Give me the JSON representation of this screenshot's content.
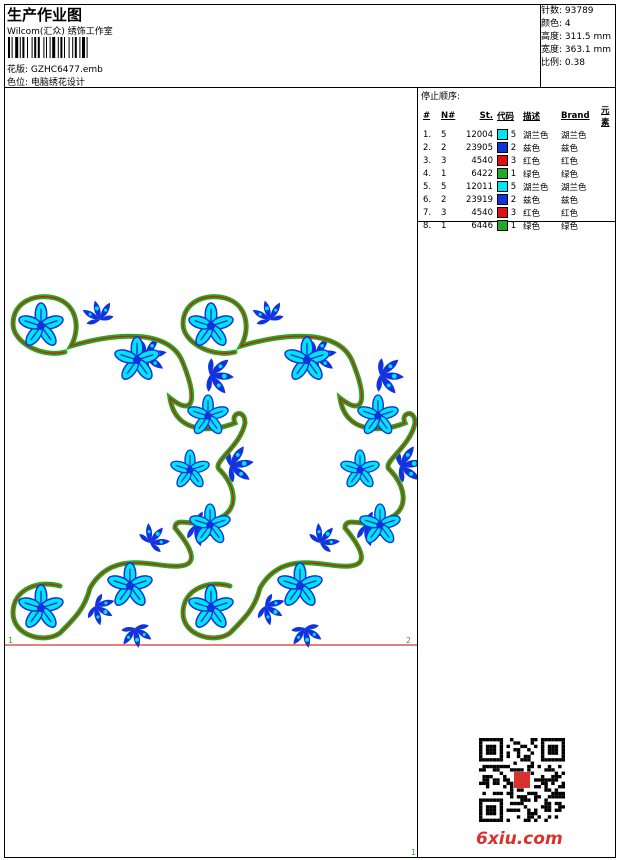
{
  "header": {
    "title": "生产作业图",
    "studio": "Wilcom(汇众) 绣饰工作室",
    "design_line": "花版: GZHC6477.emb",
    "color_line": "色位: 电脑绣花设计"
  },
  "stats": {
    "stitches": "针数: 93789",
    "colors": "颜色: 4",
    "height": "高度: 311.5 mm",
    "width": "宽度: 363.1 mm",
    "scale": "比例: 0.38"
  },
  "stop_sequence": {
    "title": "停止顺序:",
    "headers": [
      "#",
      "N#",
      "St.",
      "代码",
      "描述",
      "Brand",
      "元素"
    ],
    "rows": [
      {
        "idx": "1.",
        "n": "5",
        "st": "12004",
        "swatch": "#00e5f0",
        "code": "5",
        "desc": "湖兰色",
        "brand": "湖兰色"
      },
      {
        "idx": "2.",
        "n": "2",
        "st": "23905",
        "swatch": "#1133dd",
        "code": "2",
        "desc": "兹色",
        "brand": "兹色"
      },
      {
        "idx": "3.",
        "n": "3",
        "st": "4540",
        "swatch": "#dd1111",
        "code": "3",
        "desc": "红色",
        "brand": "红色"
      },
      {
        "idx": "4.",
        "n": "1",
        "st": "6422",
        "swatch": "#22aa22",
        "code": "1",
        "desc": "绿色",
        "brand": "绿色"
      },
      {
        "idx": "5.",
        "n": "5",
        "st": "12011",
        "swatch": "#00e5f0",
        "code": "5",
        "desc": "湖兰色",
        "brand": "湖兰色"
      },
      {
        "idx": "6.",
        "n": "2",
        "st": "23919",
        "swatch": "#1133dd",
        "code": "2",
        "desc": "兹色",
        "brand": "兹色"
      },
      {
        "idx": "7.",
        "n": "3",
        "st": "4540",
        "swatch": "#dd1111",
        "code": "3",
        "desc": "红色",
        "brand": "红色"
      },
      {
        "idx": "8.",
        "n": "1",
        "st": "6446",
        "swatch": "#22aa22",
        "code": "1",
        "desc": "绿色",
        "brand": "绿色"
      }
    ]
  },
  "markers": {
    "m1": "1",
    "m2": "2",
    "m3": "1"
  },
  "watermark": "6xiu.com",
  "colors": {
    "cyan": "#00e5f0",
    "blue": "#1133dd",
    "red": "#dd1111",
    "green": "#22aa22",
    "guide": "#cc0000"
  }
}
